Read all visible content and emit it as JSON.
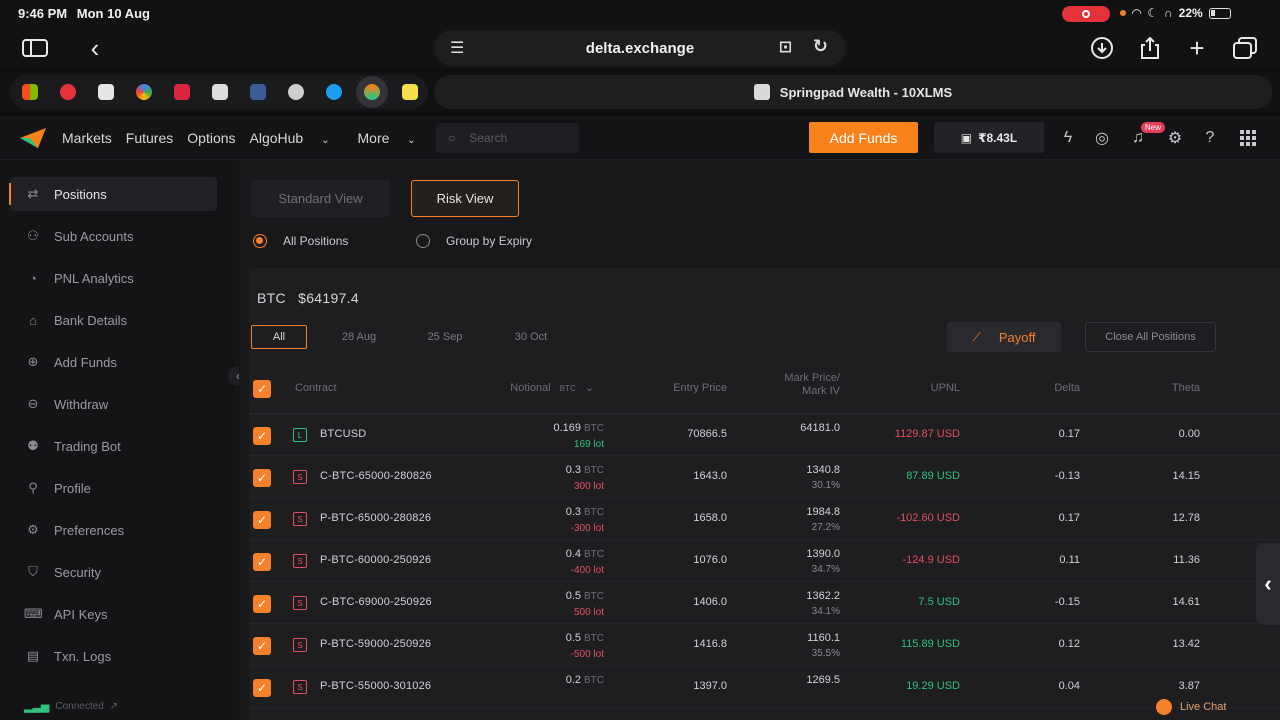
{
  "status": {
    "time": "9:46 PM",
    "date": "Mon 10 Aug",
    "battery": "22%"
  },
  "browser": {
    "url": "delta.exchange",
    "tab_title": "Springpad Wealth - 10XLMS"
  },
  "header": {
    "nav": [
      "Markets",
      "Futures",
      "Options",
      "AlgoHub",
      "More"
    ],
    "search_placeholder": "Search",
    "add_funds": "Add Funds",
    "balance": "₹8.43L",
    "new_badge": "New"
  },
  "sidebar": {
    "items": [
      {
        "label": "Positions",
        "icon": "positions-icon"
      },
      {
        "label": "Sub Accounts",
        "icon": "user-icon"
      },
      {
        "label": "PNL Analytics",
        "icon": "chart-icon"
      },
      {
        "label": "Bank Details",
        "icon": "bank-icon"
      },
      {
        "label": "Add Funds",
        "icon": "plus-circle-icon"
      },
      {
        "label": "Withdraw",
        "icon": "withdraw-icon"
      },
      {
        "label": "Trading Bot",
        "icon": "bot-icon"
      },
      {
        "label": "Profile",
        "icon": "profile-icon"
      },
      {
        "label": "Preferences",
        "icon": "gear-icon"
      },
      {
        "label": "Security",
        "icon": "shield-icon"
      },
      {
        "label": "API Keys",
        "icon": "key-icon"
      },
      {
        "label": "Txn. Logs",
        "icon": "log-icon"
      }
    ],
    "connection": "Connected"
  },
  "views": {
    "standard": "Standard View",
    "risk": "Risk View"
  },
  "grouping": {
    "all": "All Positions",
    "expiry": "Group by Expiry"
  },
  "asset": {
    "symbol": "BTC",
    "price": "$64197.4"
  },
  "expiry_tabs": [
    "All",
    "28 Aug",
    "25 Sep",
    "30 Oct"
  ],
  "actions": {
    "payoff": "Payoff",
    "close_all": "Close All Positions"
  },
  "columns": {
    "contract": "Contract",
    "notional": "Notional",
    "notional_unit": "BTC",
    "entry": "Entry Price",
    "mark_line1": "Mark Price/",
    "mark_line2": "Mark IV",
    "upnl": "UPNL",
    "delta": "Delta",
    "theta": "Theta"
  },
  "rows": [
    {
      "side": "L",
      "contract": "BTCUSD",
      "notional": "0.169",
      "unit": "BTC",
      "lots": "169 lot",
      "lots_color": "green",
      "entry": "70866.5",
      "mark": "64181.0",
      "iv": "",
      "upnl": "1129.87 USD",
      "upnl_color": "red",
      "delta": "0.17",
      "theta": "0.00"
    },
    {
      "side": "S",
      "contract": "C-BTC-65000-280826",
      "notional": "0.3",
      "unit": "BTC",
      "lots": "300 lot",
      "lots_color": "red",
      "entry": "1643.0",
      "mark": "1340.8",
      "iv": "30.1%",
      "upnl": "87.89 USD",
      "upnl_color": "green",
      "delta": "-0.13",
      "theta": "14.15"
    },
    {
      "side": "S",
      "contract": "P-BTC-65000-280826",
      "notional": "0.3",
      "unit": "BTC",
      "lots": "-300 lot",
      "lots_color": "red",
      "entry": "1658.0",
      "mark": "1984.8",
      "iv": "27.2%",
      "upnl": "-102.60 USD",
      "upnl_color": "red",
      "delta": "0.17",
      "theta": "12.78"
    },
    {
      "side": "S",
      "contract": "P-BTC-60000-250926",
      "notional": "0.4",
      "unit": "BTC",
      "lots": "-400 lot",
      "lots_color": "red",
      "entry": "1076.0",
      "mark": "1390.0",
      "iv": "34.7%",
      "upnl": "-124.9 USD",
      "upnl_color": "red",
      "delta": "0.11",
      "theta": "11.36"
    },
    {
      "side": "S",
      "contract": "C-BTC-69000-250926",
      "notional": "0.5",
      "unit": "BTC",
      "lots": "500 lot",
      "lots_color": "red",
      "entry": "1406.0",
      "mark": "1362.2",
      "iv": "34.1%",
      "upnl": "7.5 USD",
      "upnl_color": "green",
      "delta": "-0.15",
      "theta": "14.61"
    },
    {
      "side": "S",
      "contract": "P-BTC-59000-250926",
      "notional": "0.5",
      "unit": "BTC",
      "lots": "-500 lot",
      "lots_color": "red",
      "entry": "1416.8",
      "mark": "1160.1",
      "iv": "35.5%",
      "upnl": "115.89 USD",
      "upnl_color": "green",
      "delta": "0.12",
      "theta": "13.42"
    },
    {
      "side": "S",
      "contract": "P-BTC-55000-301026",
      "notional": "0.2",
      "unit": "BTC",
      "lots": "",
      "lots_color": "red",
      "entry": "1397.0",
      "mark": "1269.5",
      "iv": "",
      "upnl": "19.29 USD",
      "upnl_color": "green",
      "delta": "0.04",
      "theta": "3.87"
    }
  ],
  "live_chat": "Live Chat",
  "colors": {
    "accent": "#f7821b",
    "positive": "#2ec27e",
    "negative": "#e05060"
  }
}
